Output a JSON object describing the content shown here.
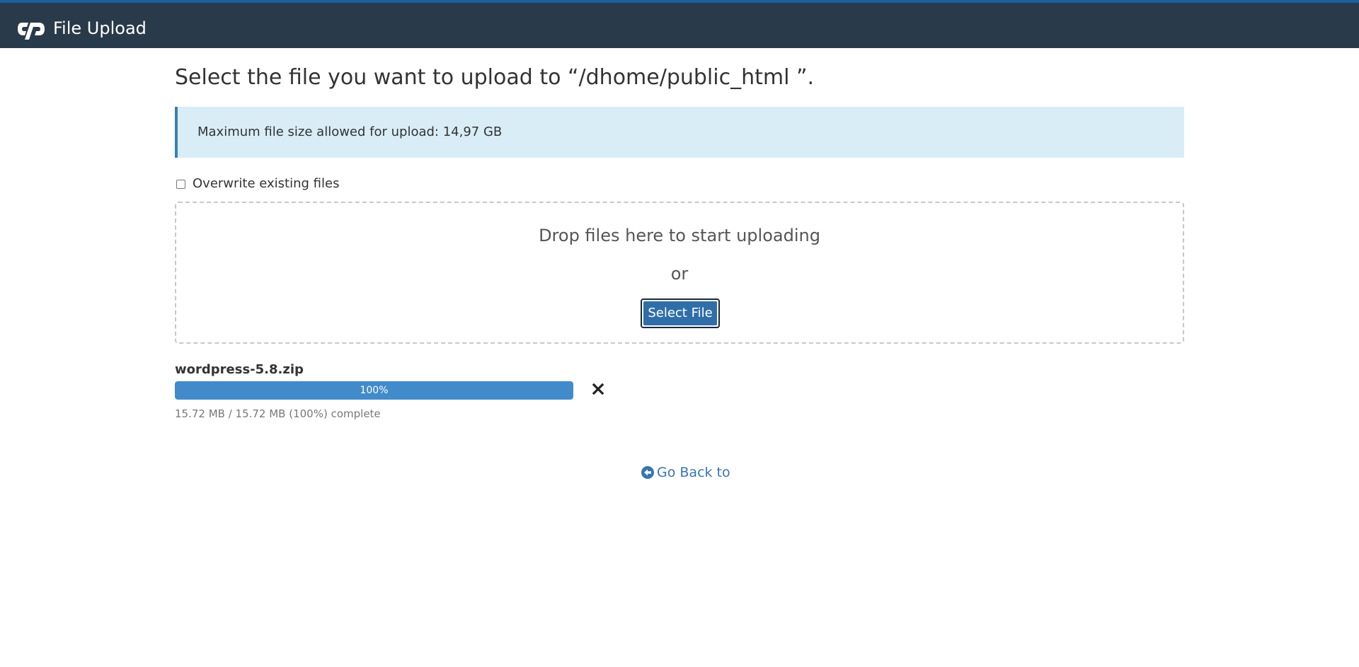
{
  "header": {
    "title": "File Upload",
    "logo_icon": "cpanel-logo-icon"
  },
  "main": {
    "heading": "Select the file you want to upload to “/dhome/public_html ”.",
    "info_text": "Maximum file size allowed for upload: 14,97 GB",
    "overwrite": {
      "label": "Overwrite existing files",
      "checked": false
    },
    "dropzone": {
      "drop_text": "Drop files here to start uploading",
      "or_text": "or",
      "select_button_label": "Select File"
    },
    "uploads": [
      {
        "file_name": "wordpress-5.8.zip",
        "progress_percent": 100,
        "progress_label": "100%",
        "status_text": "15.72 MB / 15.72 MB (100%) complete",
        "cancel_icon": "close-icon"
      }
    ],
    "go_back": {
      "label": "Go Back to",
      "icon": "circle-arrow-left-icon"
    }
  },
  "colors": {
    "header_bg": "#293a4a",
    "header_accent": "#1d5f9e",
    "info_bg": "#d9edf7",
    "info_border": "#3980b6",
    "primary_button": "#2f6ea9",
    "progress_fill": "#428bca",
    "link": "#3875b0"
  }
}
